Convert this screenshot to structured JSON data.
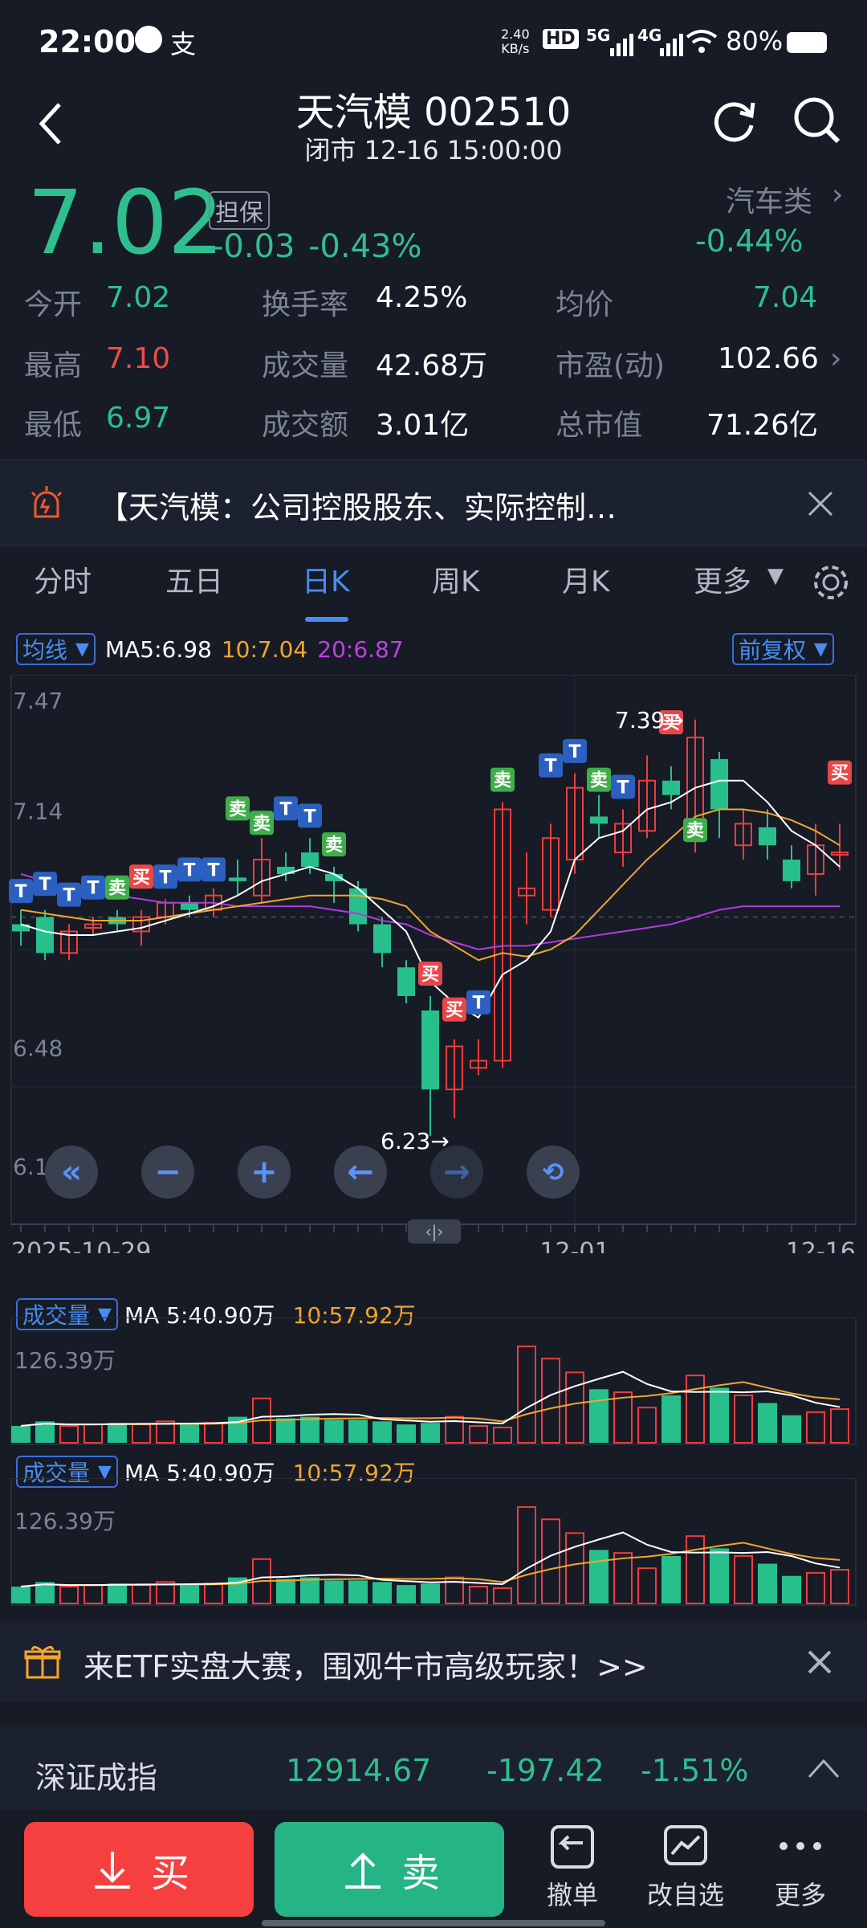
{
  "status": {
    "time": "22:00",
    "speed_top": "2.40",
    "speed_bottom": "KB/s",
    "hd": "HD",
    "sig5": "5G",
    "sig4": "4G",
    "battery": "80%"
  },
  "header": {
    "title": "天汽模 002510",
    "subtitle": "闭市 12-16 15:00:00"
  },
  "quote": {
    "price": "7.02",
    "tag": "担保",
    "change": "-0.03",
    "change_pct": "-0.43%",
    "sector": "汽车类",
    "sector_pct": "-0.44%"
  },
  "stats": [
    {
      "label": "今开",
      "value": "7.02",
      "color": "green"
    },
    {
      "label": "换手率",
      "value": "4.25%",
      "color": "white"
    },
    {
      "label": "均价",
      "value": "7.04",
      "color": "green"
    },
    {
      "label": "最高",
      "value": "7.10",
      "color": "red"
    },
    {
      "label": "成交量",
      "value": "42.68万",
      "color": "white"
    },
    {
      "label": "市盈(动)",
      "value": "102.66",
      "color": "white"
    },
    {
      "label": "最低",
      "value": "6.97",
      "color": "green"
    },
    {
      "label": "成交额",
      "value": "3.01亿",
      "color": "white"
    },
    {
      "label": "总市值",
      "value": "71.26亿",
      "color": "white"
    }
  ],
  "notice": {
    "text": "【天汽模：公司控股股东、实际控制…"
  },
  "tabs": [
    "分时",
    "五日",
    "日K",
    "周K",
    "月K",
    "更多"
  ],
  "active_tab": "日K",
  "ma_bar": {
    "dropdown": "均线",
    "ma5": "MA5:6.98",
    "ma10": "10:7.04",
    "ma20": "20:6.87",
    "adjust": "前复权"
  },
  "chart_data": {
    "type": "candlestick",
    "y_ticks": [
      "7.47",
      "7.14",
      "6.48",
      "6.15"
    ],
    "x_ticks": [
      "2025-10-29",
      "12-01",
      "12-16"
    ],
    "high_label": "7.39→",
    "low_label": "6.23→",
    "signals": {
      "buy": "买",
      "sell": "卖",
      "t": "T"
    },
    "candles": [
      {
        "o": 6.82,
        "c": 6.8,
        "h": 6.86,
        "l": 6.76
      },
      {
        "o": 6.84,
        "c": 6.74,
        "h": 6.86,
        "l": 6.72
      },
      {
        "o": 6.74,
        "c": 6.8,
        "h": 6.82,
        "l": 6.72
      },
      {
        "o": 6.81,
        "c": 6.82,
        "h": 6.84,
        "l": 6.79
      },
      {
        "o": 6.84,
        "c": 6.82,
        "h": 6.86,
        "l": 6.8
      },
      {
        "o": 6.8,
        "c": 6.84,
        "h": 6.86,
        "l": 6.76
      },
      {
        "o": 6.84,
        "c": 6.88,
        "h": 6.89,
        "l": 6.82
      },
      {
        "o": 6.88,
        "c": 6.86,
        "h": 6.9,
        "l": 6.84
      },
      {
        "o": 6.86,
        "c": 6.9,
        "h": 6.92,
        "l": 6.84
      },
      {
        "o": 6.95,
        "c": 6.94,
        "h": 7.0,
        "l": 6.9
      },
      {
        "o": 6.9,
        "c": 7.0,
        "h": 7.06,
        "l": 6.88
      },
      {
        "o": 6.98,
        "c": 6.96,
        "h": 7.02,
        "l": 6.94
      },
      {
        "o": 7.02,
        "c": 6.98,
        "h": 7.06,
        "l": 6.96
      },
      {
        "o": 6.96,
        "c": 6.94,
        "h": 6.98,
        "l": 6.88
      },
      {
        "o": 6.92,
        "c": 6.82,
        "h": 6.94,
        "l": 6.8
      },
      {
        "o": 6.82,
        "c": 6.74,
        "h": 6.84,
        "l": 6.7
      },
      {
        "o": 6.7,
        "c": 6.62,
        "h": 6.72,
        "l": 6.6
      },
      {
        "o": 6.58,
        "c": 6.36,
        "h": 6.62,
        "l": 6.23
      },
      {
        "o": 6.36,
        "c": 6.48,
        "h": 6.5,
        "l": 6.28
      },
      {
        "o": 6.42,
        "c": 6.44,
        "h": 6.5,
        "l": 6.4
      },
      {
        "o": 6.44,
        "c": 7.14,
        "h": 7.16,
        "l": 6.42
      },
      {
        "o": 6.9,
        "c": 6.92,
        "h": 7.02,
        "l": 6.82
      },
      {
        "o": 6.86,
        "c": 7.06,
        "h": 7.1,
        "l": 6.84
      },
      {
        "o": 7.0,
        "c": 7.2,
        "h": 7.24,
        "l": 6.96
      },
      {
        "o": 7.12,
        "c": 7.1,
        "h": 7.18,
        "l": 7.06
      },
      {
        "o": 7.02,
        "c": 7.1,
        "h": 7.14,
        "l": 6.98
      },
      {
        "o": 7.08,
        "c": 7.22,
        "h": 7.29,
        "l": 7.06
      },
      {
        "o": 7.22,
        "c": 7.18,
        "h": 7.26,
        "l": 7.14
      },
      {
        "o": 7.1,
        "c": 7.34,
        "h": 7.39,
        "l": 7.02
      },
      {
        "o": 7.28,
        "c": 7.14,
        "h": 7.3,
        "l": 7.06
      },
      {
        "o": 7.04,
        "c": 7.1,
        "h": 7.14,
        "l": 7.0
      },
      {
        "o": 7.09,
        "c": 7.04,
        "h": 7.14,
        "l": 7.0
      },
      {
        "o": 7.0,
        "c": 6.94,
        "h": 7.04,
        "l": 6.92
      },
      {
        "o": 6.96,
        "c": 7.04,
        "h": 7.1,
        "l": 6.9
      },
      {
        "o": 7.02,
        "c": 7.02,
        "h": 7.1,
        "l": 6.97
      }
    ],
    "ma5": [
      6.82,
      6.8,
      6.79,
      6.79,
      6.8,
      6.81,
      6.83,
      6.85,
      6.87,
      6.9,
      6.94,
      6.96,
      6.98,
      6.96,
      6.92,
      6.86,
      6.8,
      6.66,
      6.6,
      6.56,
      6.68,
      6.72,
      6.8,
      7.0,
      7.06,
      7.08,
      7.14,
      7.16,
      7.2,
      7.22,
      7.22,
      7.16,
      7.08,
      7.04,
      6.98
    ],
    "ma10": [
      6.86,
      6.85,
      6.84,
      6.83,
      6.83,
      6.83,
      6.84,
      6.85,
      6.86,
      6.87,
      6.88,
      6.89,
      6.9,
      6.9,
      6.9,
      6.89,
      6.87,
      6.8,
      6.76,
      6.72,
      6.74,
      6.73,
      6.75,
      6.79,
      6.86,
      6.93,
      7.0,
      7.06,
      7.12,
      7.14,
      7.14,
      7.13,
      7.11,
      7.08,
      7.04
    ],
    "ma20": [
      6.96,
      6.94,
      6.92,
      6.91,
      6.9,
      6.89,
      6.88,
      6.88,
      6.88,
      6.87,
      6.87,
      6.87,
      6.87,
      6.86,
      6.85,
      6.83,
      6.82,
      6.79,
      6.77,
      6.75,
      6.76,
      6.76,
      6.77,
      6.78,
      6.79,
      6.8,
      6.81,
      6.82,
      6.84,
      6.86,
      6.87,
      6.87,
      6.87,
      6.87,
      6.87
    ]
  },
  "volume": {
    "dropdown": "成交量",
    "ma5": "MA 5:40.90万",
    "ma10": "10:57.92万",
    "max_label": "126.39万",
    "bars": [
      22,
      28,
      22,
      24,
      26,
      24,
      28,
      24,
      26,
      34,
      58,
      32,
      34,
      30,
      30,
      28,
      24,
      26,
      34,
      22,
      20,
      126,
      110,
      92,
      70,
      66,
      46,
      62,
      88,
      72,
      62,
      52,
      36,
      40,
      44
    ]
  },
  "ad": {
    "text": "来ETF实盘大赛，围观牛市高级玩家！>>"
  },
  "index": {
    "name": "深证成指",
    "value": "12914.67",
    "change": "-197.42",
    "pct": "-1.51%"
  },
  "bottom": {
    "buy": "买",
    "sell": "卖",
    "cancel": "撤单",
    "watch": "改自选",
    "more": "更多"
  }
}
